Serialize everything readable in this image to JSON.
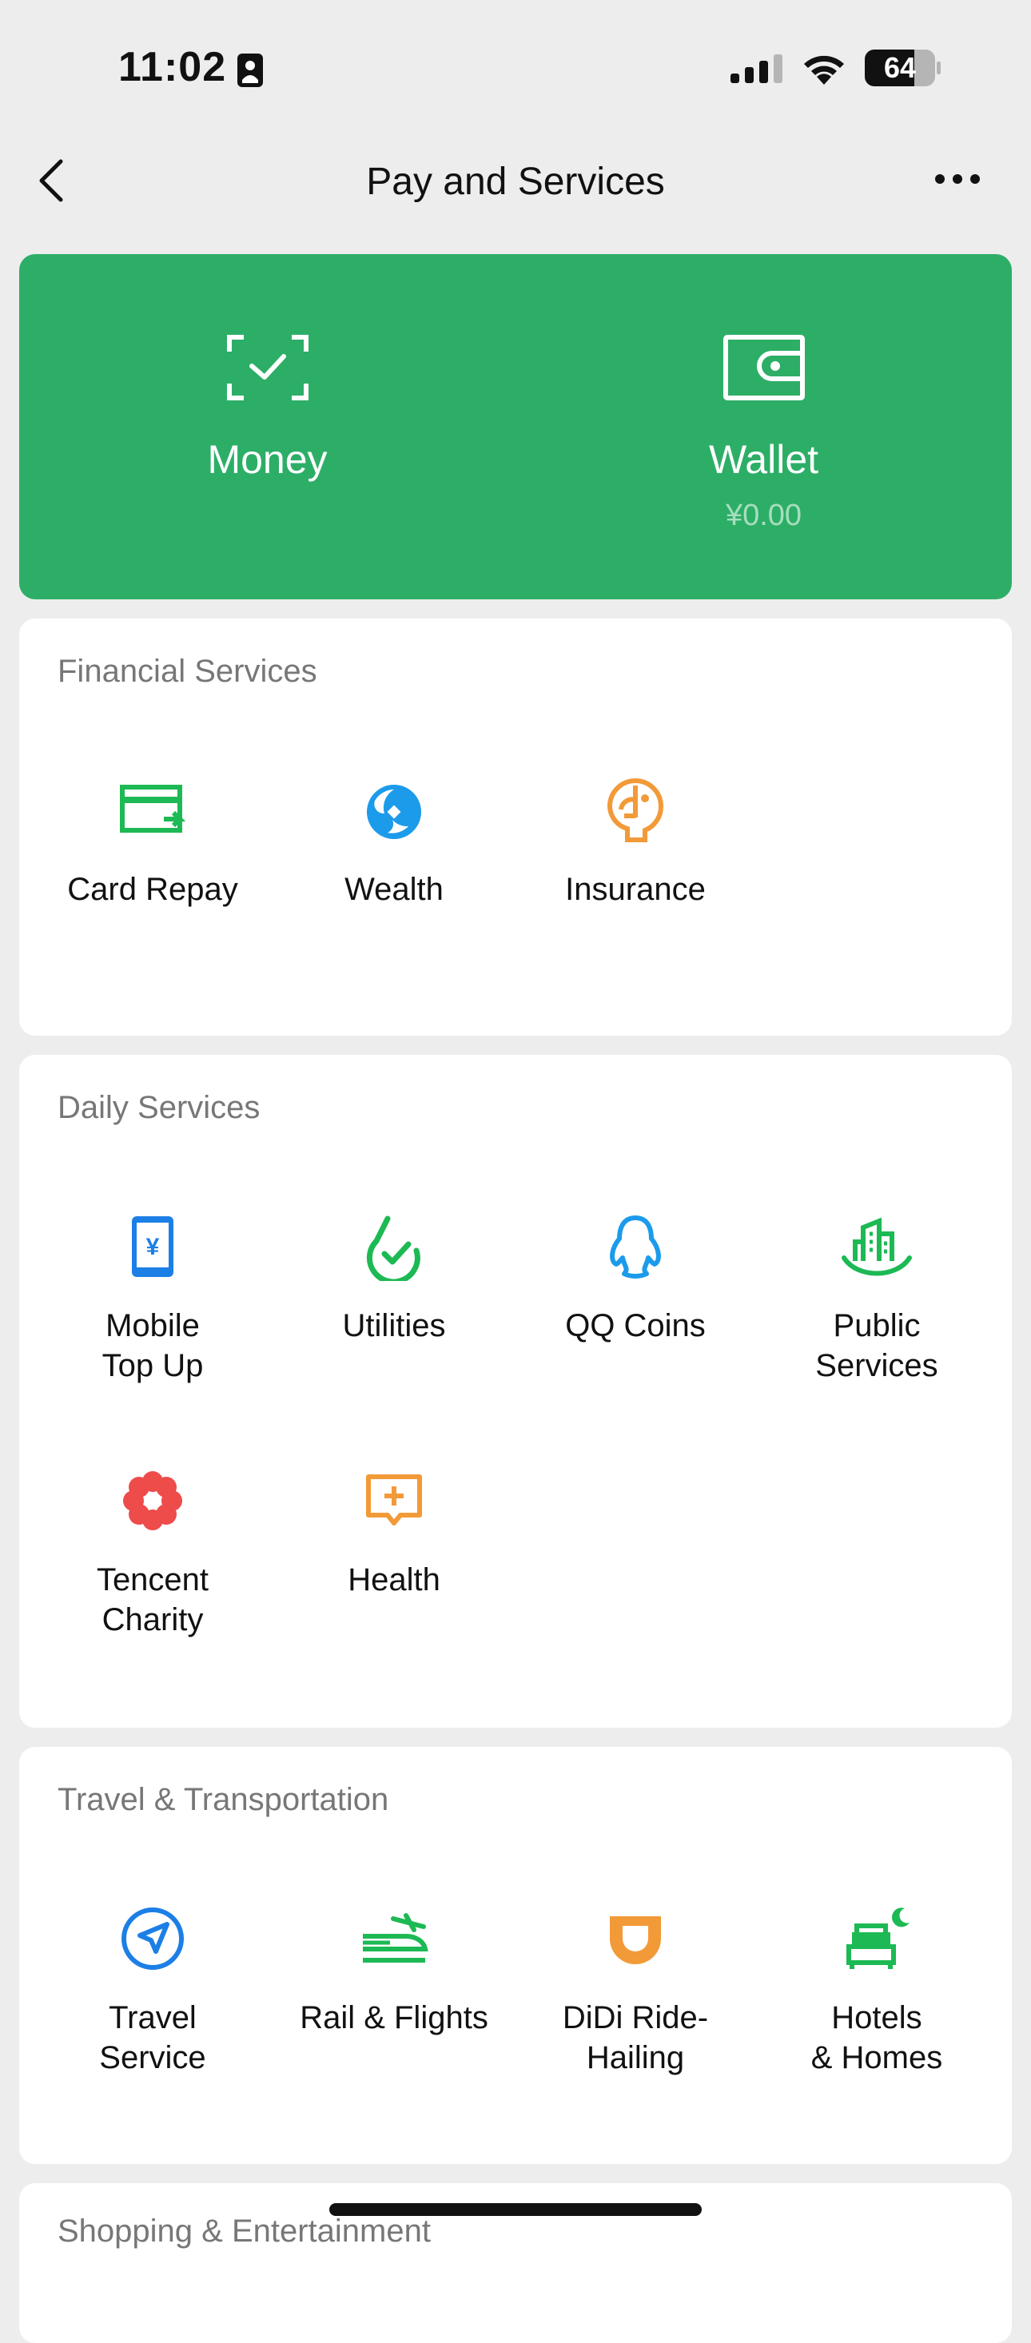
{
  "status_bar": {
    "time": "11:02",
    "battery": "64"
  },
  "nav": {
    "title": "Pay and Services"
  },
  "hero": {
    "money_label": "Money",
    "wallet_label": "Wallet",
    "wallet_balance": "¥0.00",
    "color": "#2DAE67"
  },
  "financial": {
    "title": "Financial Services",
    "items": [
      {
        "label": "Card Repay",
        "icon": "card-repay-icon"
      },
      {
        "label": "Wealth",
        "icon": "wealth-icon"
      },
      {
        "label": "Insurance",
        "icon": "insurance-icon"
      }
    ]
  },
  "daily": {
    "title": "Daily Services",
    "items": [
      {
        "label": "Mobile\nTop Up",
        "icon": "mobile-top-up-icon"
      },
      {
        "label": "Utilities",
        "icon": "utilities-icon"
      },
      {
        "label": "QQ Coins",
        "icon": "qq-coins-icon"
      },
      {
        "label": "Public\nServices",
        "icon": "public-services-icon"
      },
      {
        "label": "Tencent\nCharity",
        "icon": "tencent-charity-icon"
      },
      {
        "label": "Health",
        "icon": "health-icon"
      }
    ]
  },
  "travel": {
    "title": "Travel & Transportation",
    "items": [
      {
        "label": "Travel\nService",
        "icon": "travel-service-icon"
      },
      {
        "label": "Rail & Flights",
        "icon": "rail-flights-icon"
      },
      {
        "label": "DiDi Ride-\nHailing",
        "icon": "didi-icon"
      },
      {
        "label": "Hotels\n& Homes",
        "icon": "hotels-homes-icon"
      }
    ]
  },
  "shopping": {
    "title": "Shopping & Entertainment"
  },
  "colors": {
    "green": "#1DB954",
    "blue": "#1C7FE6",
    "orange": "#F29A38",
    "red": "#EE4B4B"
  }
}
